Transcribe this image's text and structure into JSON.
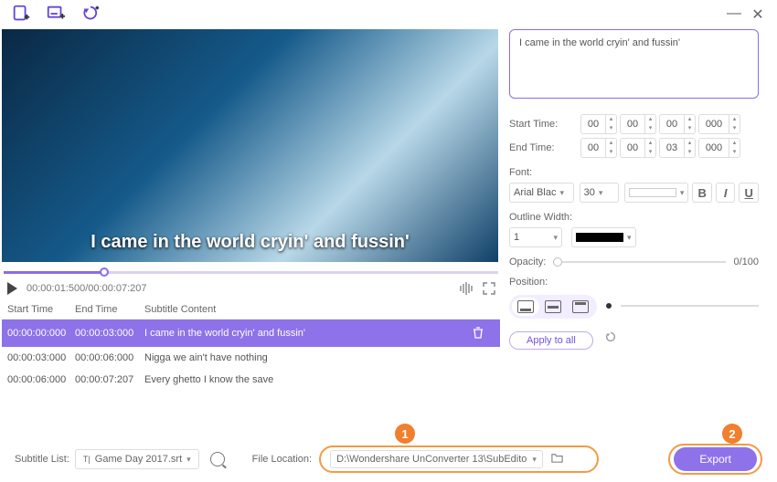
{
  "subtitle_text": "I came in the world cryin' and fussin'",
  "start_time_label": "Start Time:",
  "end_time_label": "End Time:",
  "start_time": {
    "hh": "00",
    "mm": "00",
    "ss": "00",
    "ms": "000"
  },
  "end_time": {
    "hh": "00",
    "mm": "00",
    "ss": "03",
    "ms": "000"
  },
  "font_label": "Font:",
  "font_name": "Arial Blac",
  "font_size": "30",
  "outline_label": "Outline Width:",
  "outline_width": "1",
  "opacity_label": "Opacity:",
  "opacity_value": "0/100",
  "position_label": "Position:",
  "apply_all_label": "Apply to all",
  "video_overlay": "I came in the world cryin' and fussin'",
  "playback_time": "00:00:01:500/00:00:07:207",
  "columns": {
    "start": "Start Time",
    "end": "End Time",
    "content": "Subtitle Content"
  },
  "rows": [
    {
      "start": "00:00:00:000",
      "end": "00:00:03:000",
      "content": "I came in the world cryin' and fussin'"
    },
    {
      "start": "00:00:03:000",
      "end": "00:00:06:000",
      "content": "Nigga we ain't have nothing"
    },
    {
      "start": "00:00:06:000",
      "end": "00:00:07:207",
      "content": "Every ghetto I know the save"
    }
  ],
  "subtitle_list_label": "Subtitle List:",
  "subtitle_file": "Game Day 2017.srt",
  "file_location_label": "File Location:",
  "file_location": "D:\\Wondershare UnConverter 13\\SubEdito",
  "export_label": "Export",
  "badge1": "1",
  "badge2": "2"
}
